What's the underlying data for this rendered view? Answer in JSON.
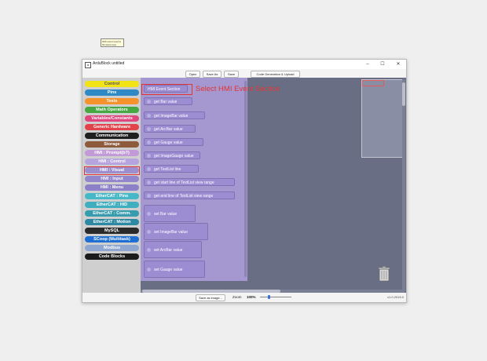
{
  "window": {
    "title": "ArduBlock untitled",
    "icon": "ardublock-app-icon",
    "minimize": "–",
    "maximize": "☐",
    "close": "✕"
  },
  "toolbar": {
    "open": "Open",
    "save_as": "Save As",
    "save": "Save",
    "upload": "Code Generation & Upload"
  },
  "palette": {
    "categories": [
      {
        "label": "Control",
        "color": "#f2e317"
      },
      {
        "label": "Pins",
        "color": "#2f89c5"
      },
      {
        "label": "Tests",
        "color": "#f6922b"
      },
      {
        "label": "Math Operators",
        "color": "#46a843"
      },
      {
        "label": "Variables/Constants",
        "color": "#e0457e"
      },
      {
        "label": "Generic Hardware",
        "color": "#e2434b"
      },
      {
        "label": "Communication",
        "color": "#1f1f1f"
      },
      {
        "label": "Storage",
        "color": "#8d5a3b"
      },
      {
        "label": "HMI : Prompt(b?)",
        "color": "#c39ad8"
      },
      {
        "label": "HMI : Control",
        "color": "#b5a4de"
      },
      {
        "label": "HMI : Visual",
        "color": "#9d8ed0"
      },
      {
        "label": "HMI : Input",
        "color": "#9386cc"
      },
      {
        "label": "HMI : Menu",
        "color": "#8c80c8"
      },
      {
        "label": "EtherCAT : Pins",
        "color": "#47b8c8"
      },
      {
        "label": "EtherCAT : HID",
        "color": "#3fafc0"
      },
      {
        "label": "EtherCAT : Comm.",
        "color": "#379cae"
      },
      {
        "label": "EtherCAT : Motion",
        "color": "#2d88a4"
      },
      {
        "label": "MySQL",
        "color": "#2a2a2a"
      },
      {
        "label": "SCoop (Multitask)",
        "color": "#1e6ed4"
      },
      {
        "label": "Modbus",
        "color": "#8fa6d0"
      },
      {
        "label": "Code Blocks",
        "color": "#1b1b1b"
      }
    ]
  },
  "flyout": {
    "blocks": [
      {
        "label": "HMI Event Section"
      },
      {
        "label": "get Bar value"
      },
      {
        "label": "get ImageBar value"
      },
      {
        "label": "get ArcBar value"
      },
      {
        "label": "get Gauge value"
      },
      {
        "label": "get ImageGauge value"
      },
      {
        "label": "get TextList line"
      },
      {
        "label": "get start line of TextList view range"
      },
      {
        "label": "get end line of TextList view range"
      },
      {
        "label": "set Bar value"
      },
      {
        "label": "set ImageBar value"
      },
      {
        "label": "set ArcBar value"
      },
      {
        "label": "set Gauge value"
      }
    ],
    "tooltip": "HMI event used in firmware loop"
  },
  "annotation": {
    "text": "Select HMI Event Section",
    "color": "#e23636"
  },
  "trash": {
    "icon": "trash-can-icon"
  },
  "statusbar": {
    "save_image": "Save as image...",
    "zoom_label": "Zoom",
    "zoom_value": "100%",
    "version": "v1.0.2015.0"
  }
}
